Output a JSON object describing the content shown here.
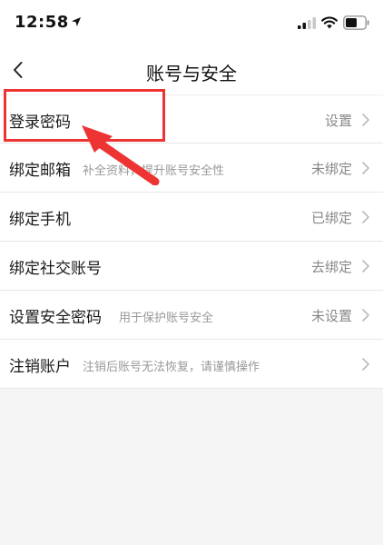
{
  "status_bar": {
    "time": "12:58",
    "icons": [
      "location-arrow-icon",
      "cellular-signal-icon",
      "wifi-icon",
      "battery-icon"
    ]
  },
  "nav": {
    "back_icon": "chevron-left-icon",
    "title": "账号与安全"
  },
  "settings": {
    "items": [
      {
        "label": "登录密码",
        "hint": "",
        "value": "设置"
      },
      {
        "label": "绑定邮箱",
        "hint": "补全资料，提升账号安全性",
        "value": "未绑定"
      },
      {
        "label": "绑定手机",
        "hint": "",
        "value": "已绑定"
      },
      {
        "label": "绑定社交账号",
        "hint": "",
        "value": "去绑定"
      },
      {
        "label": "设置安全密码",
        "hint": "用于保护账号安全",
        "value": "未设置"
      },
      {
        "label": "注销账户",
        "hint": "注销后账号无法恢复，请谨慎操作",
        "value": ""
      }
    ]
  },
  "colors": {
    "annotation": "#ee3333",
    "hint_text": "#999999",
    "value_text": "#888888",
    "background": "#f5f5f5"
  }
}
